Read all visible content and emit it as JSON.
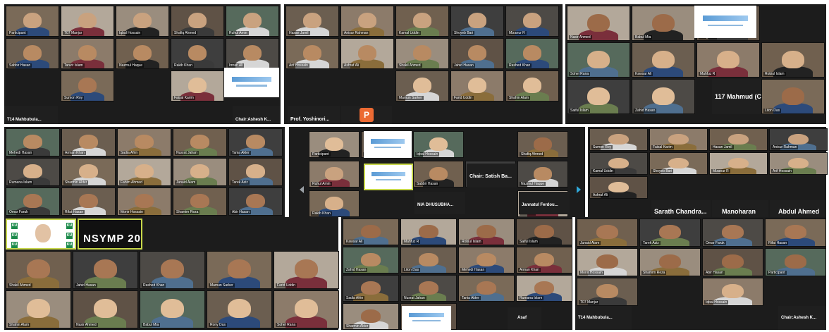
{
  "meeting": {
    "title": "Zoom meeting gallery views collage",
    "accent_color": "#c8d84a",
    "panel_background": "#1c1c1c"
  },
  "labels": {
    "speaker_prof": "Prof. Yoshinori...",
    "mahmud": "117 Mahmud (C...",
    "chair_ashesh_top": "Chair:Ashesh K...",
    "mahbubul_top": "T14 Mahbubula...",
    "chair_satish": "Chair: Satish Ba...",
    "shahhasib": "NIA DHUSUBHA...",
    "jannatul": "Jannatul Ferdou...",
    "sarath": "Sarath Chandra...",
    "manoharan": "Manoharan",
    "abdul_ahmed": "Abdul Ahmed",
    "nsymp": "NSYMP 20",
    "asaf": "Asaf",
    "mahbubul_bottom": "T14 Mahbubula...",
    "chair_ashesh_bottom": "Chair:Ashesh K...",
    "orange_letter": "P"
  },
  "participants": {
    "p01": "Participant",
    "p02": "T07 Manjur",
    "p03": "Iqbal Hossain",
    "p04": "Shafiq Ahmed",
    "p05": "Ruhul Amin",
    "p06": "Sabbir Hasan",
    "p07": "Tanvir Islam",
    "p08": "Nazmul Haque",
    "p09": "Rakib Khan",
    "p10": "Imran Ali",
    "p11": "Sumon Roy",
    "p12": "Faisal Karim",
    "p13": "Hasan Jamil",
    "p14": "Anisur Rahman",
    "p15": "Kamal Uddin",
    "p16": "Shoyeb Bari",
    "p17": "Mizanur R",
    "p18": "Arif Hossain",
    "p19": "Ashraf Ali",
    "p20": "Shakil Ahmed",
    "p21": "Jahid Hasan",
    "p22": "Rashed Khan",
    "p23": "Mamun Sarker",
    "p24": "Farid Uddin",
    "p25": "Shahin Alam",
    "p26": "Nasir Ahmed",
    "p27": "Babul Mia",
    "p28": "Rony Das",
    "p29": "Sohel Rana",
    "p30": "Kawsar Ali",
    "p31": "Mahfuz R",
    "p32": "Robiul Islam",
    "p33": "Saiful Islam",
    "p34": "Zahid Hasan",
    "p35": "Liton Das",
    "p36": "Mehedi Hasan",
    "p37": "Arman Khan",
    "p38": "Sadia Afrin",
    "p39": "Nusrat Jahan",
    "p40": "Tania Akter",
    "p41": "Rumana Islam",
    "p42": "Sharmin Akter",
    "p43": "Fahim Ahmed",
    "p44": "Junaid Alam",
    "p45": "Tarek Aziz",
    "p46": "Omar Faruk",
    "p47": "Rifat Hasan",
    "p48": "Monir Hossain",
    "p49": "Shamim Reza",
    "p50": "Abir Hasan"
  }
}
